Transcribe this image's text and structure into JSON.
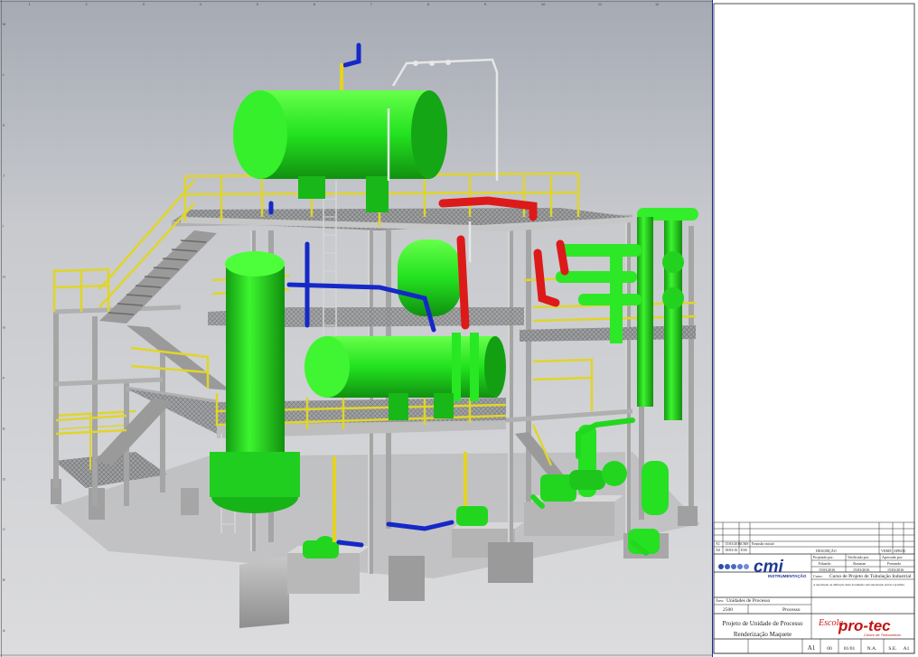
{
  "title_block": {
    "revision_rows": [
      {
        "rev": "A1",
        "date": "15/03/2016",
        "by": "CMS",
        "description": "Emissão inicial"
      },
      {
        "rev": "A0",
        "date": "18/03/16",
        "by": "ESS",
        "description": ""
      }
    ],
    "revision_headers": {
      "description": "DESCRIÇÃO",
      "check": "VERIF.",
      "approve": "APROV."
    },
    "signatures": {
      "headers": [
        "Projetado por:",
        "Verificado por:",
        "Aprovado por:"
      ],
      "names": [
        "Eduardo",
        "Jhonatan",
        "Fernando"
      ],
      "dates": [
        "15/03/2016",
        "15/03/2016",
        "15/03/2016"
      ]
    },
    "company_logo_text": "cmi",
    "company_sub": "INSTRUMENTAÇÃO",
    "course_label": "Curso:",
    "course": "Curso de Projeto de Tubulação Industrial",
    "disclaimer": "A reprodução ou utilização deste documento sem autorização prévia é proibida.",
    "area_label": "Área:",
    "area": "Unidades de Processo",
    "unit_code": "2500",
    "unit_name": "Processo",
    "project_title": "Projeto de Unidade de Processo",
    "drawing_title": "Renderização Maquete",
    "format": "A1",
    "sheet": "00",
    "sheet_total": "01/01",
    "scale": "N.A.",
    "size": "S.E.",
    "revision": "A1",
    "school_logo_top": "Escola",
    "school_logo": "pro-tec",
    "school_logo_sub": "Centro de Treinamento"
  },
  "border": {
    "columns": [
      "1",
      "2",
      "3",
      "4",
      "5",
      "6",
      "7",
      "8",
      "9",
      "10",
      "11",
      "12",
      "13",
      "14",
      "15",
      "16"
    ],
    "rows": [
      "M",
      "L",
      "K",
      "J",
      "I",
      "H",
      "G",
      "F",
      "E",
      "D",
      "C",
      "B",
      "A"
    ]
  },
  "colors": {
    "equipment": "#22ee22",
    "structure": "#bbbbbb",
    "handrail": "#e0d52a",
    "pipe_blue": "#1528c8",
    "pipe_red": "#dd1a1a",
    "background": "#d0d0d4"
  }
}
